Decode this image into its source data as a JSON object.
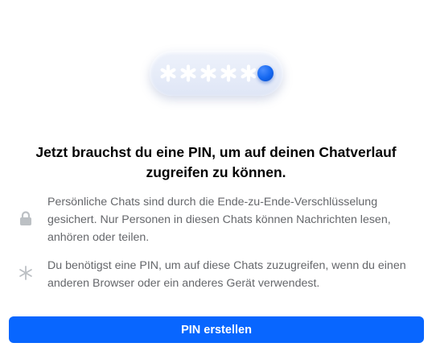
{
  "illustration": {
    "icon": "pin-entry-illustration",
    "masked_digits": 5,
    "dot_color": "#1467f0"
  },
  "headline": "Jetzt brauchst du eine PIN, um auf deinen Chatverlauf zugreifen zu können.",
  "info_items": [
    {
      "icon": "lock-icon",
      "text": "Persönliche Chats sind durch die Ende-zu-Ende-Verschlüsselung gesichert. Nur Personen in diesen Chats können Nachrichten lesen, anhören oder teilen."
    },
    {
      "icon": "asterisk-icon",
      "text": "Du benötigst eine PIN, um auf diese Chats zuzugreifen, wenn du einen anderen Browser oder ein anderes Gerät verwendest."
    }
  ],
  "primary_button": {
    "label": "PIN erstellen",
    "color": "#0866ff"
  },
  "colors": {
    "heading": "#050505",
    "secondary_text": "#65676b",
    "icon_gray": "#bcc0c4"
  }
}
